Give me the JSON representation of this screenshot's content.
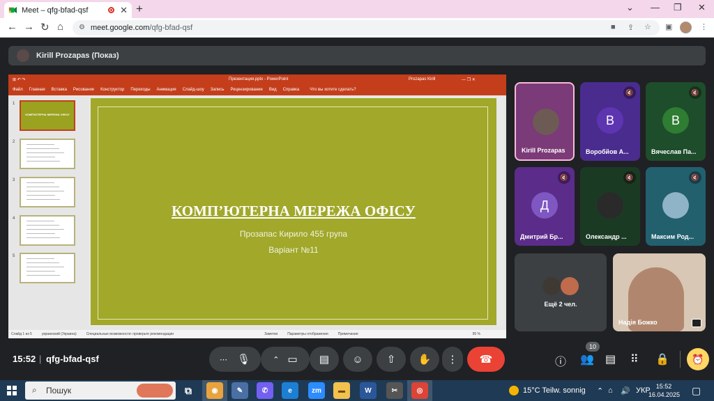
{
  "browser": {
    "tab_title": "Meet – qfg-bfad-qsf",
    "url_host": "meet.google.com",
    "url_path": "/qfg-bfad-qsf"
  },
  "presenter": {
    "label": "Kirill Prozapas (Показ)"
  },
  "powerpoint": {
    "window_title": "Презентация.pptx  -  PowerPoint",
    "user": "Prozapas Kirill",
    "menu": [
      "Файл",
      "Главная",
      "Вставка",
      "Рисование",
      "Конструктор",
      "Переходы",
      "Анимация",
      "Слайд-шоу",
      "Запись",
      "Рецензирование",
      "Вид",
      "Справка"
    ],
    "tell_me": "Что вы хотите сделать?",
    "thumb_title": "КОМП'ЮТЕРНА МЕРЕЖА ОФІСУ",
    "thumb_numbers": [
      "1",
      "2",
      "3",
      "4",
      "5"
    ],
    "slide": {
      "title": "КОМП’ЮТЕРНА МЕРЕЖА ОФІСУ",
      "subtitle": "Прозапас Кирило 455 група",
      "variant": "Варіант №11"
    },
    "status": {
      "slide_of": "Слайд 1 из 5",
      "language": "украинский (Украина)",
      "accessibility": "Специальные возможности: проверьте рекомендации",
      "notes": "Заметки",
      "display": "Параметры отображения",
      "comments": "Примечания",
      "zoom": "95 %"
    }
  },
  "participants": [
    {
      "name": "Kirill Prozapas",
      "type": "photo",
      "bg": "#7b3a78",
      "muted": false
    },
    {
      "name": "Воробйов А...",
      "type": "letter",
      "letter": "В",
      "bg": "#4a2c8f",
      "avatar": "#5e35b1",
      "muted": true
    },
    {
      "name": "Вячеслав Па...",
      "type": "letter",
      "letter": "В",
      "bg": "#1e4d2b",
      "avatar": "#2e7d32",
      "muted": true
    },
    {
      "name": "Дмитрий Бр...",
      "type": "letter",
      "letter": "Д",
      "bg": "#5b2c8a",
      "avatar": "#7e57c2",
      "muted": true
    },
    {
      "name": "Олександр ...",
      "type": "photo",
      "bg": "#1b3a24",
      "muted": true
    },
    {
      "name": "Максим Род...",
      "type": "photo",
      "bg": "#22606e",
      "muted": true
    }
  ],
  "more_participants": "Ещё 2 чел.",
  "self_tile": {
    "name": "Надія Божко"
  },
  "controls": {
    "time": "15:52",
    "meeting_code": "qfg-bfad-qsf",
    "people_count": "10"
  },
  "taskbar": {
    "search_placeholder": "Пошук",
    "weather": "15°C  Teilw. sonnig",
    "language": "УКР",
    "time": "15:52",
    "date": "16.04.2025"
  },
  "colors": {
    "meet_bg": "#202124",
    "slide_green": "#a1a82a",
    "ppt_red": "#c43e1c",
    "end_call": "#ea4335",
    "timer_yellow": "#fdd663"
  }
}
